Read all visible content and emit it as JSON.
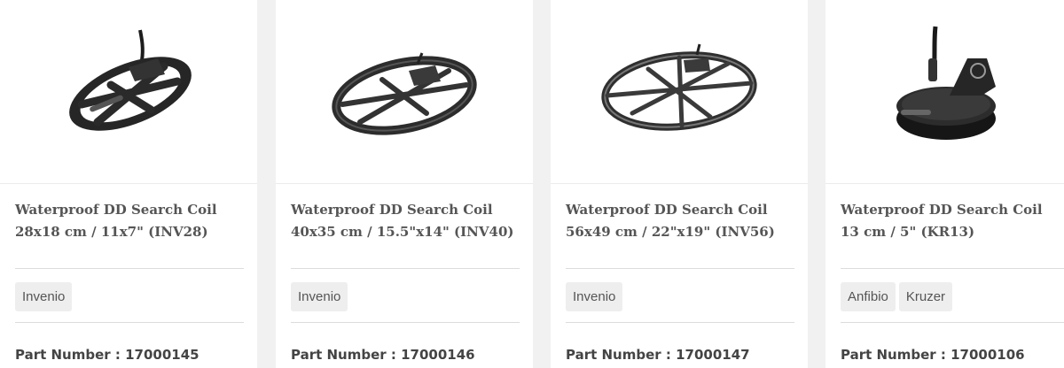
{
  "products": [
    {
      "title_line1": "Waterproof DD Search Coil",
      "title_line2": "28x18 cm / 11x7\" (INV28)",
      "tags": [
        "Invenio"
      ],
      "part_label": "Part Number : 17000145"
    },
    {
      "title_line1": "Waterproof DD Search Coil",
      "title_line2": "40x35 cm / 15.5\"x14\" (INV40)",
      "tags": [
        "Invenio"
      ],
      "part_label": "Part Number : 17000146"
    },
    {
      "title_line1": "Waterproof DD Search Coil",
      "title_line2": "56x49 cm / 22\"x19\" (INV56)",
      "tags": [
        "Invenio"
      ],
      "part_label": "Part Number : 17000147"
    },
    {
      "title_line1": "Waterproof DD Search Coil",
      "title_line2": "13 cm / 5\" (KR13)",
      "tags": [
        "Anfibio",
        "Kruzer"
      ],
      "part_label": "Part Number : 17000106"
    }
  ]
}
